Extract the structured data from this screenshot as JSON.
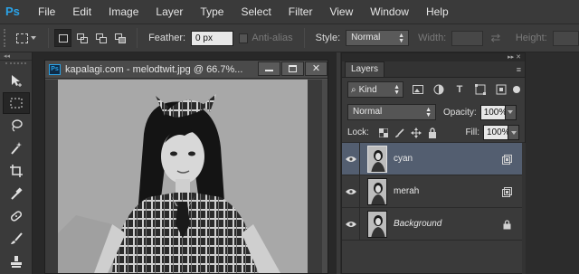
{
  "app": {
    "logo": "Ps"
  },
  "menu": [
    "File",
    "Edit",
    "Image",
    "Layer",
    "Type",
    "Select",
    "Filter",
    "View",
    "Window",
    "Help"
  ],
  "options": {
    "feather_label": "Feather:",
    "feather_value": "0 px",
    "antialias_label": "Anti-alias",
    "style_label": "Style:",
    "style_value": "Normal",
    "width_label": "Width:",
    "height_label": "Height:"
  },
  "document": {
    "badge": "Ps",
    "title": "kapalagi.com - melodtwit.jpg @ 66.7%..."
  },
  "layers_panel": {
    "tab": "Layers",
    "kind_value": "Kind",
    "blend_mode": "Normal",
    "opacity_label": "Opacity:",
    "opacity_value": "100%",
    "lock_label": "Lock:",
    "fill_label": "Fill:",
    "fill_value": "100%",
    "layers": [
      {
        "name": "cyan",
        "selected": true,
        "badge": "layer-style-icon"
      },
      {
        "name": "merah",
        "selected": false,
        "badge": "layer-style-icon"
      },
      {
        "name": "Background",
        "selected": false,
        "badge": "lock-icon"
      }
    ]
  },
  "colors": {
    "accent": "#2aa3e8",
    "selected_layer": "#535e70"
  }
}
